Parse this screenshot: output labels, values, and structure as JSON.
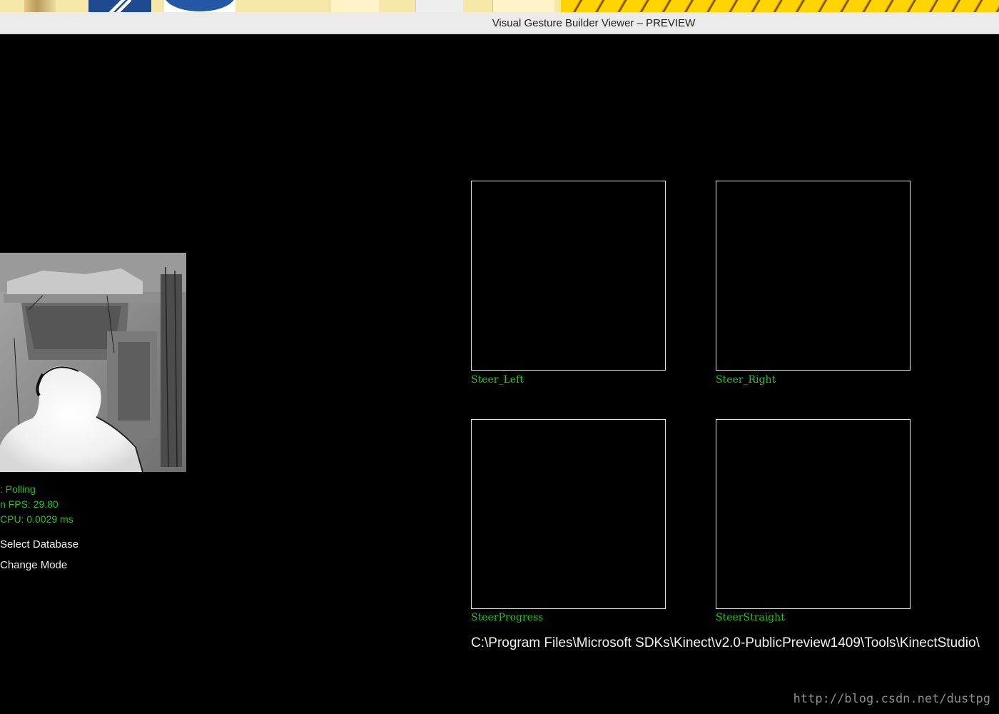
{
  "window": {
    "title": "Visual Gesture Builder Viewer – PREVIEW"
  },
  "taskbar": {
    "thumbnails": [
      "avatar-thumbnail",
      "visual-studio-thumbnail",
      "blue-circle-app-thumbnail",
      "folder-thumbnail",
      "document-thumbnail",
      "folder-thumbnail-2",
      "wallpaper-thumbnail"
    ]
  },
  "status": {
    "mode": ": Polling",
    "fps": "n FPS: 29.80",
    "cpu": "CPU: 0.0029 ms"
  },
  "menu": {
    "select_database": "Select Database",
    "change_mode": "Change Mode"
  },
  "gestures": [
    {
      "label": "Steer_Left"
    },
    {
      "label": "Steer_Right"
    },
    {
      "label": "SteerProgress"
    },
    {
      "label": "SteerStraight"
    }
  ],
  "database_path": "C:\\Program Files\\Microsoft SDKs\\Kinect\\v2.0-PublicPreview1409\\Tools\\KinectStudio\\",
  "watermark": "http://blog.csdn.net/dustpg",
  "colors": {
    "background": "#000000",
    "status_text": "#1ec81e",
    "menu_text": "#f2f2f2",
    "box_border": "#e6e6e6",
    "title_bar": "#ebebeb"
  }
}
